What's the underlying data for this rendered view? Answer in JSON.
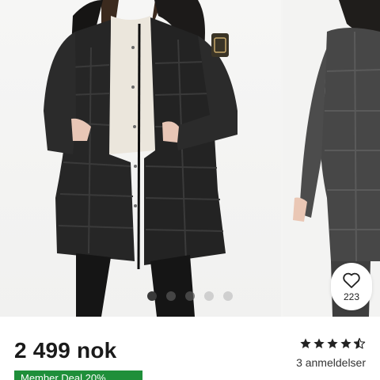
{
  "product": {
    "price": "2 499 nok",
    "rating": 4.5,
    "rating_max": 5,
    "reviews_text": "3 anmeldelser",
    "promo_text": "Member Deal 20%",
    "promo_color": "#1f8f3a"
  },
  "gallery": {
    "dot_count": 5,
    "active_index": 0,
    "favorites_count": "223",
    "favorite_icon": "heart-outline-icon"
  }
}
